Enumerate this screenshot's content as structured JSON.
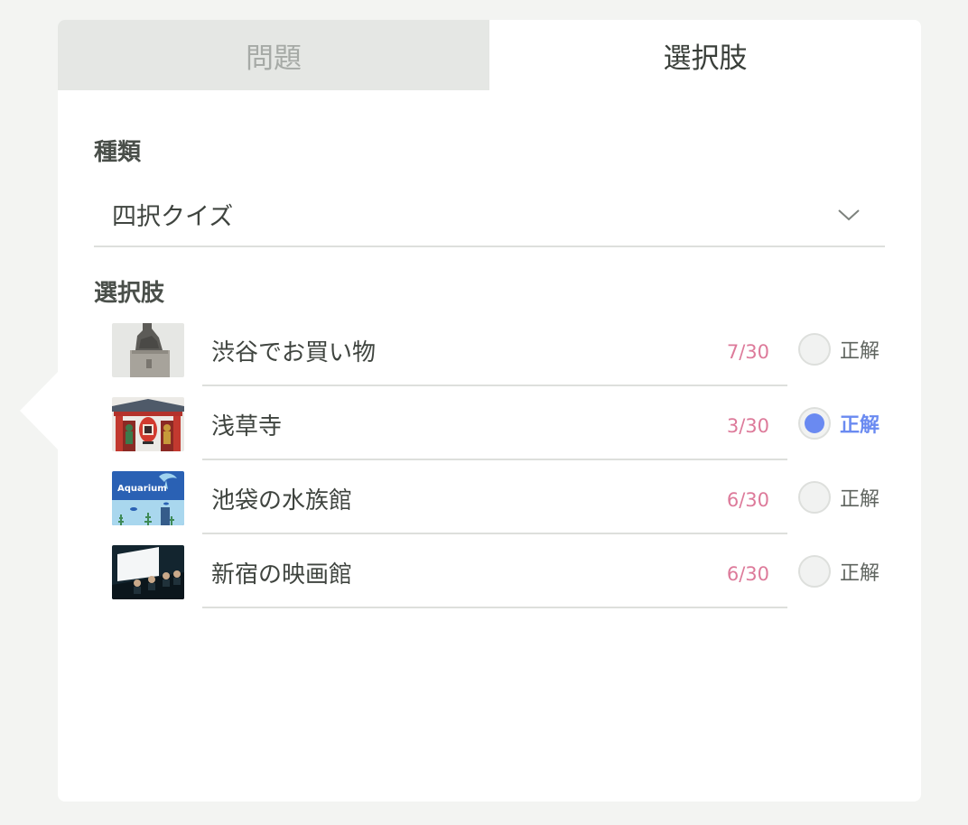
{
  "tabs": [
    {
      "label": "問題",
      "active": false
    },
    {
      "label": "選択肢",
      "active": true
    }
  ],
  "type_section": {
    "label": "種類",
    "selected": "四択クイズ"
  },
  "choices_section": {
    "label": "選択肢",
    "correct_label": "正解",
    "items": [
      {
        "label": "渋谷でお買い物",
        "count": "7/30",
        "correct": false,
        "image": "hachiko-statue"
      },
      {
        "label": "浅草寺",
        "count": "3/30",
        "correct": true,
        "image": "kaminarimon-gate"
      },
      {
        "label": "池袋の水族館",
        "count": "6/30",
        "correct": false,
        "image": "aquarium",
        "image_text": "Aquarium"
      },
      {
        "label": "新宿の映画館",
        "count": "6/30",
        "correct": false,
        "image": "movie-theater"
      }
    ]
  },
  "colors": {
    "accent": "#6a8af1",
    "count": "#dd7a9a",
    "background": "#f3f4f2"
  }
}
